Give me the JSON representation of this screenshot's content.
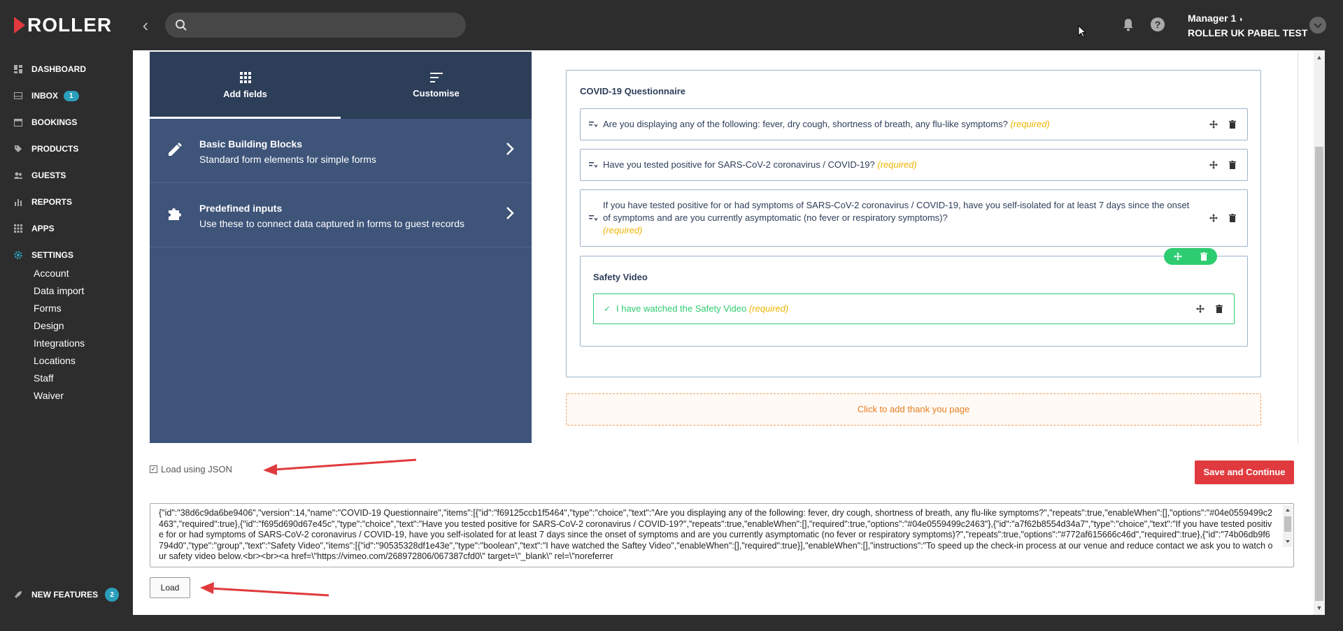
{
  "app": {
    "logo": "ROLLER",
    "user_name": "Manager 1",
    "venue": "ROLLER UK PABEL TEST",
    "search_placeholder": ""
  },
  "sidebar": {
    "items": [
      {
        "label": "DASHBOARD",
        "icon": "dashboard-icon"
      },
      {
        "label": "INBOX",
        "icon": "inbox-icon",
        "badge": "1"
      },
      {
        "label": "BOOKINGS",
        "icon": "calendar-icon"
      },
      {
        "label": "PRODUCTS",
        "icon": "tag-icon"
      },
      {
        "label": "GUESTS",
        "icon": "guests-icon"
      },
      {
        "label": "REPORTS",
        "icon": "reports-icon"
      },
      {
        "label": "APPS",
        "icon": "apps-icon"
      },
      {
        "label": "SETTINGS",
        "icon": "gear-icon"
      }
    ],
    "settings_sub": [
      "Account",
      "Data import",
      "Forms",
      "Design",
      "Integrations",
      "Locations",
      "Staff",
      "Waiver"
    ],
    "new_features": {
      "label": "NEW FEATURES",
      "badge": "2"
    }
  },
  "builder": {
    "tabs": [
      {
        "label": "Add fields"
      },
      {
        "label": "Customise"
      }
    ],
    "blocks": [
      {
        "title": "Basic Building Blocks",
        "subtitle": "Standard form elements for simple forms"
      },
      {
        "title": "Predefined inputs",
        "subtitle": "Use these to connect data captured in forms to guest records"
      }
    ]
  },
  "form": {
    "title": "COVID-19 Questionnaire",
    "required_label": "(required)",
    "questions": [
      {
        "text": "Are you displaying any of the following: fever, dry cough, shortness of breath, any flu-like symptoms?"
      },
      {
        "text": "Have you tested positive for SARS-CoV-2 coronavirus / COVID-19?"
      },
      {
        "text": "If you have tested positive for or had symptoms of SARS-CoV-2 coronavirus / COVID-19, have you self-isolated for at least 7 days since the onset of symptoms and are you currently asymptomatic (no fever or respiratory symptoms)?"
      }
    ],
    "group": {
      "title": "Safety Video",
      "item": "I have watched the Safety Video"
    },
    "thank_you": "Click to add thank you page"
  },
  "actions": {
    "load_json_label": "Load using JSON",
    "load_json_checked": true,
    "save_label": "Save and Continue",
    "load_label": "Load",
    "json_text": "{\"id\":\"38d6c9da6be9406\",\"version\":14,\"name\":\"COVID-19 Questionnaire\",\"items\":[{\"id\":\"f69125ccb1f5464\",\"type\":\"choice\",\"text\":\"Are you displaying any of the following: fever, dry cough, shortness of breath, any flu-like symptoms?\",\"repeats\":true,\"enableWhen\":[],\"options\":\"#04e0559499c2463\",\"required\":true},{\"id\":\"f695d690d67e45c\",\"type\":\"choice\",\"text\":\"Have you tested positive for SARS-CoV-2 coronavirus / COVID-19?\",\"repeats\":true,\"enableWhen\":[],\"required\":true,\"options\":\"#04e0559499c2463\"},{\"id\":\"a7f62b8554d34a7\",\"type\":\"choice\",\"text\":\"If you have tested positive for or had symptoms of SARS-CoV-2 coronavirus / COVID-19, have you self-isolated for at least 7 days since the onset of symptoms and are you currently asymptomatic (no fever or respiratory symptoms)?\",\"repeats\":true,\"options\":\"#772af615666c46d\",\"required\":true},{\"id\":\"74b06db9f6794d0\",\"type\":\"group\",\"text\":\"Safety Video\",\"items\":[{\"id\":\"90535328df1e43e\",\"type\":\"boolean\",\"text\":\"I have watched the Saftey Video\",\"enableWhen\":[],\"required\":true}],\"enableWhen\":[],\"instructions\":\"To speed up the check-in process at our venue and reduce contact we ask you to watch our safety video below.<br><br><a href=\\\"https://vimeo.com/268972806/067387cfd0\\\" target=\\\"_blank\\\" rel=\\\"noreferrer"
  },
  "colors": {
    "brand": "#e03a3e",
    "panel": "#3e5479",
    "success": "#2ecc71",
    "required": "#f0b400",
    "arrow": "#e03a3e"
  }
}
